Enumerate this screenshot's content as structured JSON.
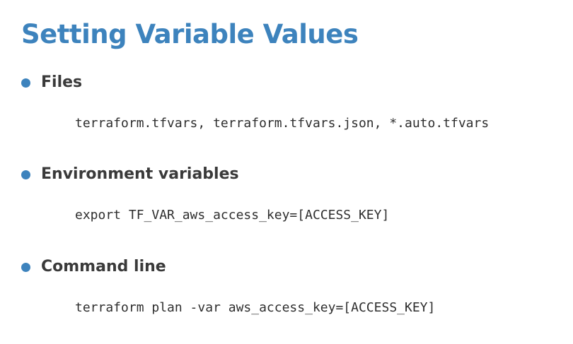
{
  "slide": {
    "title": "Setting Variable Values",
    "accent_color": "#3d83bd",
    "text_color": "#3a3a3a",
    "bullets": [
      {
        "label": "Files",
        "code": "terraform.tfvars, terraform.tfvars.json, *.auto.tfvars"
      },
      {
        "label": "Environment variables",
        "code": "export TF_VAR_aws_access_key=[ACCESS_KEY]"
      },
      {
        "label": "Command line",
        "code": "terraform plan -var aws_access_key=[ACCESS_KEY]"
      }
    ]
  }
}
